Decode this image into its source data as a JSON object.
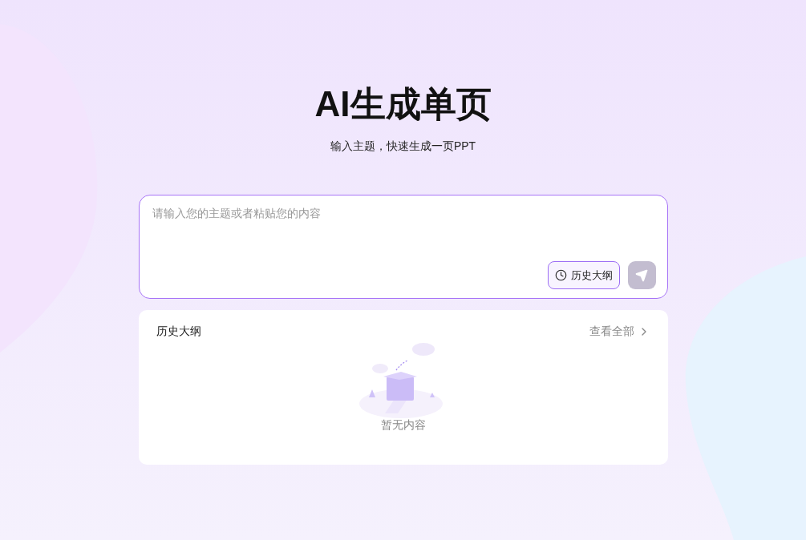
{
  "header": {
    "title": "AI生成单页",
    "subtitle": "输入主题，快速生成一页PPT"
  },
  "prompt": {
    "placeholder": "请输入您的主题或者粘贴您的内容",
    "history_button": "历史大纲",
    "send_disabled": true
  },
  "history": {
    "title": "历史大纲",
    "view_all": "查看全部",
    "empty_text": "暂无内容"
  }
}
